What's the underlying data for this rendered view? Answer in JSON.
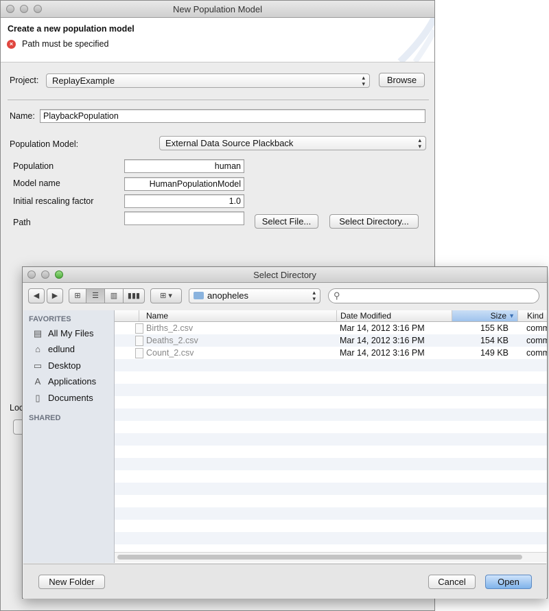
{
  "wizard": {
    "window_title": "New Population Model",
    "heading": "Create a new population model",
    "error_message": "Path must be specified",
    "project_label": "Project:",
    "project_value": "ReplayExample",
    "browse_label": "Browse",
    "name_label": "Name:",
    "name_value": "PlaybackPopulation",
    "population_model_label": "Population Model:",
    "population_model_value": "External Data Source Plackback",
    "population_label": "Population",
    "population_value": "human",
    "model_name_label": "Model name",
    "model_name_value": "HumanPopulationModel",
    "rescaling_label": "Initial rescaling factor",
    "rescaling_value": "1.0",
    "path_label": "Path",
    "path_value": "",
    "select_file_label": "Select File...",
    "select_directory_label": "Select Directory...",
    "partial_label": "Loc"
  },
  "dialog": {
    "title": "Select Directory",
    "location": "anopheles",
    "search_placeholder": "",
    "sidebar": {
      "favorites_header": "FAVORITES",
      "shared_header": "SHARED",
      "items": [
        {
          "label": "All My Files",
          "icon": "all-files-icon"
        },
        {
          "label": "edlund",
          "icon": "home-icon"
        },
        {
          "label": "Desktop",
          "icon": "desktop-icon"
        },
        {
          "label": "Applications",
          "icon": "applications-icon"
        },
        {
          "label": "Documents",
          "icon": "documents-icon"
        }
      ]
    },
    "columns": {
      "name": "Name",
      "date_modified": "Date Modified",
      "size": "Size",
      "kind": "Kind"
    },
    "files": [
      {
        "name": "Births_2.csv",
        "date": "Mar 14, 2012 3:16 PM",
        "size": "155 KB",
        "kind": "comma-separated values"
      },
      {
        "name": "Deaths_2.csv",
        "date": "Mar 14, 2012 3:16 PM",
        "size": "154 KB",
        "kind": "comma-separated values"
      },
      {
        "name": "Count_2.csv",
        "date": "Mar 14, 2012 3:16 PM",
        "size": "149 KB",
        "kind": "comma-separated values"
      }
    ],
    "new_folder_label": "New Folder",
    "cancel_label": "Cancel",
    "open_label": "Open"
  },
  "colors": {
    "error_red": "#e0463f",
    "selected_header": "#a9c9ef",
    "open_button": "#7fb3ea",
    "sidebar_bg": "#e3e7ed"
  }
}
